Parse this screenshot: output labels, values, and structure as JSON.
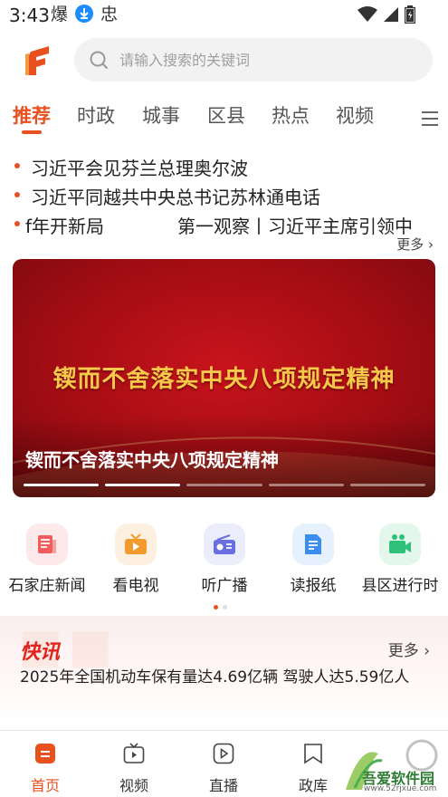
{
  "status_bar": {
    "time": "3:43",
    "left_icons": [
      "flame-notify-icon",
      "download-icon",
      "bug-icon"
    ],
    "right_icons": [
      "wifi-icon",
      "signal-icon",
      "battery-icon"
    ]
  },
  "header": {
    "logo": "app-logo",
    "search_placeholder": "请输入搜索的关键词"
  },
  "tabs": [
    {
      "label": "推荐",
      "active": true
    },
    {
      "label": "时政",
      "active": false
    },
    {
      "label": "城事",
      "active": false
    },
    {
      "label": "区县",
      "active": false
    },
    {
      "label": "热点",
      "active": false
    },
    {
      "label": "视频",
      "active": false
    }
  ],
  "headlines": [
    "习近平会见芬兰总理奥尔波",
    "习近平同越共中央总书记苏林通电话",
    "f年开新局",
    "第一观察丨习近平主席引领中"
  ],
  "headlines_more": "更多",
  "banner": {
    "image_text": "锲而不舍落实中央八项规定精神",
    "caption": "锲而不舍落实中央八项规定精神",
    "slides": 5,
    "active_slide": 2
  },
  "services": [
    {
      "label": "石家庄新闻",
      "icon": "newspaper-icon",
      "color": "#f25c5c",
      "bg": "#fde9e9"
    },
    {
      "label": "看电视",
      "icon": "tv-icon",
      "color": "#f29a2e",
      "bg": "#fdf0e1"
    },
    {
      "label": "听广播",
      "icon": "radio-icon",
      "color": "#6a6ee0",
      "bg": "#ecedfb"
    },
    {
      "label": "读报纸",
      "icon": "document-icon",
      "color": "#3c8df0",
      "bg": "#e6f1fd"
    },
    {
      "label": "县区进行时",
      "icon": "video-camera-icon",
      "color": "#2fc07a",
      "bg": "#e3f7ed"
    }
  ],
  "news_flash": {
    "title": "快讯",
    "more": "更多",
    "text": "2025年全国机动车保有量达4.69亿辆 驾驶人达5.59亿人"
  },
  "bottom_nav": [
    {
      "label": "首页",
      "active": true,
      "icon": "home-icon"
    },
    {
      "label": "视频",
      "active": false,
      "icon": "tv-play-icon"
    },
    {
      "label": "直播",
      "active": false,
      "icon": "live-play-icon"
    },
    {
      "label": "政库",
      "active": false,
      "icon": "bookmark-icon"
    }
  ],
  "watermark": {
    "text": "吾爱软件园",
    "url": "www.52rjxue.com"
  },
  "colors": {
    "accent": "#e8501f",
    "banner_red": "#b5101a",
    "banner_gold": "#f6c94a",
    "flash_red": "#e0231c"
  }
}
